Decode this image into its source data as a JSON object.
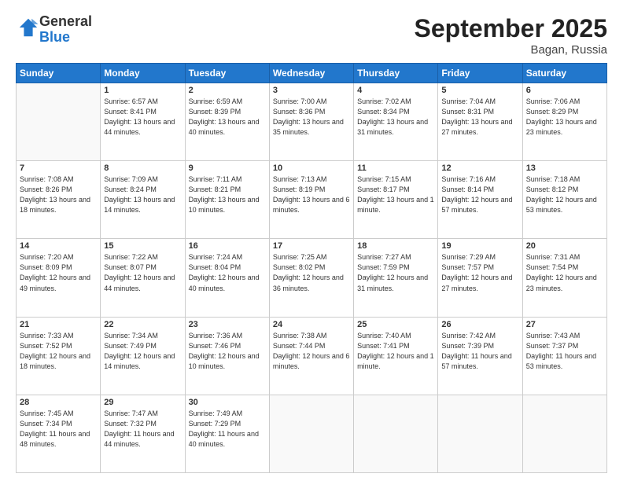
{
  "header": {
    "logo": {
      "general": "General",
      "blue": "Blue"
    },
    "title": "September 2025",
    "location": "Bagan, Russia"
  },
  "weekdays": [
    "Sunday",
    "Monday",
    "Tuesday",
    "Wednesday",
    "Thursday",
    "Friday",
    "Saturday"
  ],
  "weeks": [
    [
      {
        "day": null
      },
      {
        "day": 1,
        "sunrise": "6:57 AM",
        "sunset": "8:41 PM",
        "daylight": "13 hours and 44 minutes."
      },
      {
        "day": 2,
        "sunrise": "6:59 AM",
        "sunset": "8:39 PM",
        "daylight": "13 hours and 40 minutes."
      },
      {
        "day": 3,
        "sunrise": "7:00 AM",
        "sunset": "8:36 PM",
        "daylight": "13 hours and 35 minutes."
      },
      {
        "day": 4,
        "sunrise": "7:02 AM",
        "sunset": "8:34 PM",
        "daylight": "13 hours and 31 minutes."
      },
      {
        "day": 5,
        "sunrise": "7:04 AM",
        "sunset": "8:31 PM",
        "daylight": "13 hours and 27 minutes."
      },
      {
        "day": 6,
        "sunrise": "7:06 AM",
        "sunset": "8:29 PM",
        "daylight": "13 hours and 23 minutes."
      }
    ],
    [
      {
        "day": 7,
        "sunrise": "7:08 AM",
        "sunset": "8:26 PM",
        "daylight": "13 hours and 18 minutes."
      },
      {
        "day": 8,
        "sunrise": "7:09 AM",
        "sunset": "8:24 PM",
        "daylight": "13 hours and 14 minutes."
      },
      {
        "day": 9,
        "sunrise": "7:11 AM",
        "sunset": "8:21 PM",
        "daylight": "13 hours and 10 minutes."
      },
      {
        "day": 10,
        "sunrise": "7:13 AM",
        "sunset": "8:19 PM",
        "daylight": "13 hours and 6 minutes."
      },
      {
        "day": 11,
        "sunrise": "7:15 AM",
        "sunset": "8:17 PM",
        "daylight": "13 hours and 1 minute."
      },
      {
        "day": 12,
        "sunrise": "7:16 AM",
        "sunset": "8:14 PM",
        "daylight": "12 hours and 57 minutes."
      },
      {
        "day": 13,
        "sunrise": "7:18 AM",
        "sunset": "8:12 PM",
        "daylight": "12 hours and 53 minutes."
      }
    ],
    [
      {
        "day": 14,
        "sunrise": "7:20 AM",
        "sunset": "8:09 PM",
        "daylight": "12 hours and 49 minutes."
      },
      {
        "day": 15,
        "sunrise": "7:22 AM",
        "sunset": "8:07 PM",
        "daylight": "12 hours and 44 minutes."
      },
      {
        "day": 16,
        "sunrise": "7:24 AM",
        "sunset": "8:04 PM",
        "daylight": "12 hours and 40 minutes."
      },
      {
        "day": 17,
        "sunrise": "7:25 AM",
        "sunset": "8:02 PM",
        "daylight": "12 hours and 36 minutes."
      },
      {
        "day": 18,
        "sunrise": "7:27 AM",
        "sunset": "7:59 PM",
        "daylight": "12 hours and 31 minutes."
      },
      {
        "day": 19,
        "sunrise": "7:29 AM",
        "sunset": "7:57 PM",
        "daylight": "12 hours and 27 minutes."
      },
      {
        "day": 20,
        "sunrise": "7:31 AM",
        "sunset": "7:54 PM",
        "daylight": "12 hours and 23 minutes."
      }
    ],
    [
      {
        "day": 21,
        "sunrise": "7:33 AM",
        "sunset": "7:52 PM",
        "daylight": "12 hours and 18 minutes."
      },
      {
        "day": 22,
        "sunrise": "7:34 AM",
        "sunset": "7:49 PM",
        "daylight": "12 hours and 14 minutes."
      },
      {
        "day": 23,
        "sunrise": "7:36 AM",
        "sunset": "7:46 PM",
        "daylight": "12 hours and 10 minutes."
      },
      {
        "day": 24,
        "sunrise": "7:38 AM",
        "sunset": "7:44 PM",
        "daylight": "12 hours and 6 minutes."
      },
      {
        "day": 25,
        "sunrise": "7:40 AM",
        "sunset": "7:41 PM",
        "daylight": "12 hours and 1 minute."
      },
      {
        "day": 26,
        "sunrise": "7:42 AM",
        "sunset": "7:39 PM",
        "daylight": "11 hours and 57 minutes."
      },
      {
        "day": 27,
        "sunrise": "7:43 AM",
        "sunset": "7:37 PM",
        "daylight": "11 hours and 53 minutes."
      }
    ],
    [
      {
        "day": 28,
        "sunrise": "7:45 AM",
        "sunset": "7:34 PM",
        "daylight": "11 hours and 48 minutes."
      },
      {
        "day": 29,
        "sunrise": "7:47 AM",
        "sunset": "7:32 PM",
        "daylight": "11 hours and 44 minutes."
      },
      {
        "day": 30,
        "sunrise": "7:49 AM",
        "sunset": "7:29 PM",
        "daylight": "11 hours and 40 minutes."
      },
      {
        "day": null
      },
      {
        "day": null
      },
      {
        "day": null
      },
      {
        "day": null
      }
    ]
  ]
}
